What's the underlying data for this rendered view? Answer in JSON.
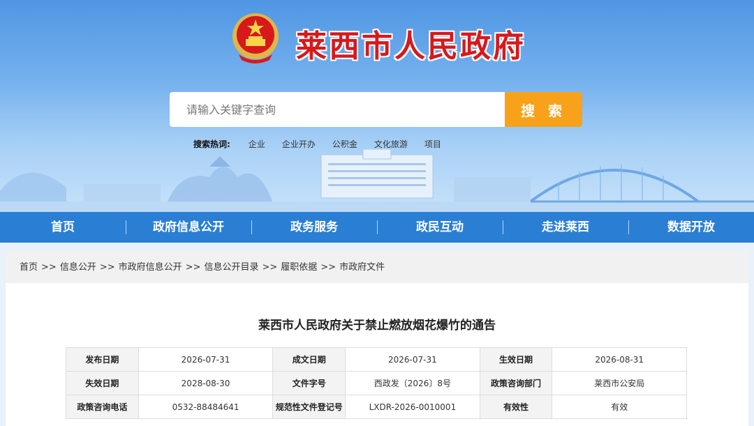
{
  "header": {
    "site_title": "莱西市人民政府",
    "emblem": "national-emblem-icon",
    "search": {
      "placeholder": "请输入关键字查询",
      "button_label": "搜 索"
    },
    "hot_label": "搜索热词:",
    "hot_words": [
      "企业",
      "企业开办",
      "公积金",
      "文化旅游",
      "项目"
    ]
  },
  "nav": {
    "items": [
      "首页",
      "政府信息公开",
      "政务服务",
      "政民互动",
      "走进莱西",
      "数据开放"
    ]
  },
  "breadcrumb": {
    "items": [
      "首页",
      "信息公开",
      "市政府信息公开",
      "信息公开目录",
      "履职依据",
      "市政府文件"
    ],
    "separator": ">>"
  },
  "document": {
    "title": "莱西市人民政府关于禁止燃放烟花爆竹的通告",
    "meta_rows": [
      [
        {
          "k": "发布日期",
          "v": "2026-07-31"
        },
        {
          "k": "成文日期",
          "v": "2026-07-31"
        },
        {
          "k": "生效日期",
          "v": "2026-08-31"
        }
      ],
      [
        {
          "k": "失效日期",
          "v": "2028-08-30"
        },
        {
          "k": "文件字号",
          "v": "西政发〔2026〕8号"
        },
        {
          "k": "政策咨询部门",
          "v": "莱西市公安局"
        }
      ],
      [
        {
          "k": "政策咨询电话",
          "v": "0532-88484641"
        },
        {
          "k": "规范性文件登记号",
          "v": "LXDR-2026-0010001"
        },
        {
          "k": "有效性",
          "v": "有效"
        }
      ]
    ]
  },
  "colors": {
    "nav_bg": "#2a7fd4",
    "title_red": "#d7191c",
    "search_button": "#f7a21a"
  }
}
